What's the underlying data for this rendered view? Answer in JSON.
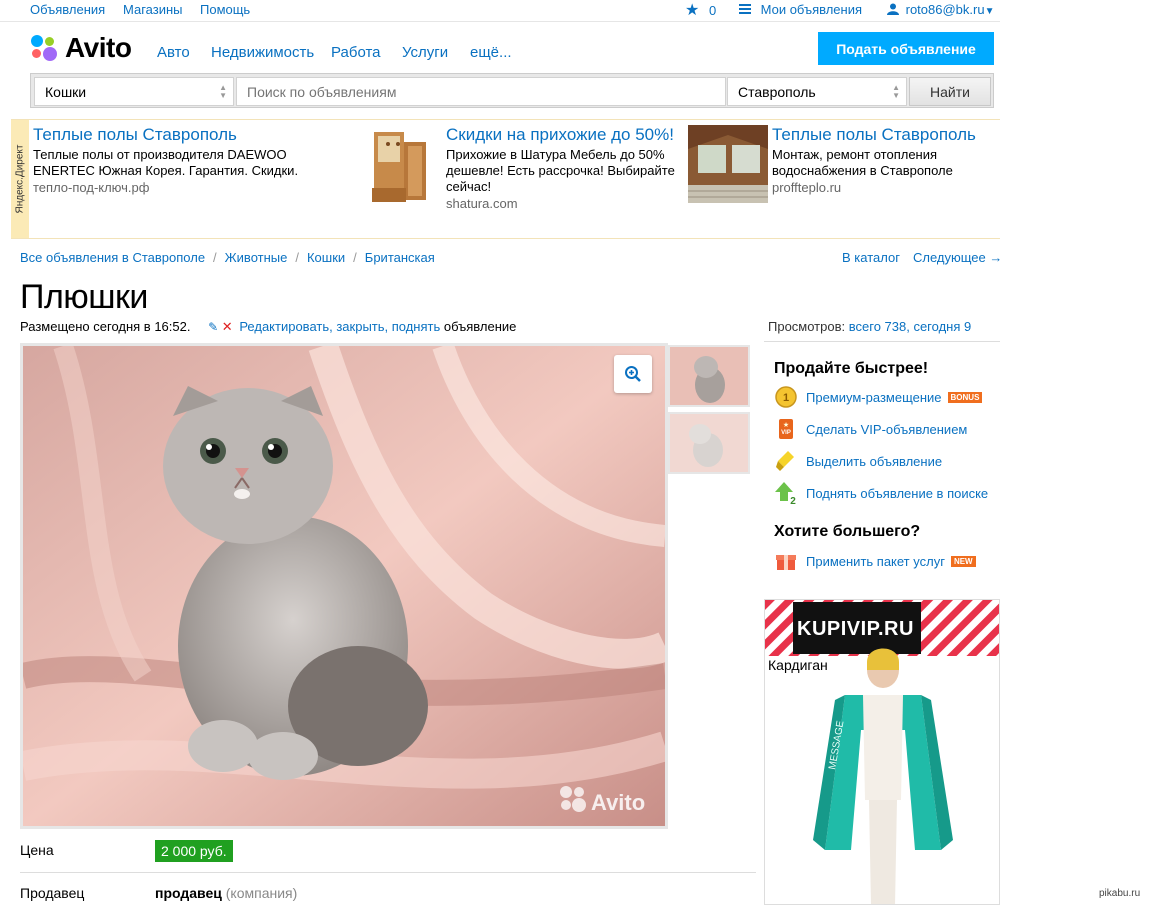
{
  "topbar": {
    "links": [
      "Объявления",
      "Магазины",
      "Помощь"
    ],
    "favorites_count": "0",
    "my_ads": "Мои объявления",
    "user": "roto86@bk.ru"
  },
  "header": {
    "logo_text": "Avito",
    "nav": [
      "Авто",
      "Недвижимость",
      "Работа",
      "Услуги",
      "ещё..."
    ],
    "post_button": "Подать объявление"
  },
  "search": {
    "category": "Кошки",
    "placeholder": "Поиск по объявлениям",
    "city": "Ставрополь",
    "button": "Найти"
  },
  "ads": {
    "label": "Яндекс.Директ",
    "items": [
      {
        "title": "Теплые полы Ставрополь",
        "desc": "Теплые полы от производителя DAEWOO ENERTEC Южная Корея. Гарантия. Скидки.",
        "url": "тепло-под-ключ.рф"
      },
      {
        "title": "Скидки на прихожие до 50%!",
        "desc": "Прихожие в Шатура Мебель до 50% дешевле! Есть рассрочка! Выбирайте сейчас!",
        "url": "shatura.com"
      },
      {
        "title": "Теплые полы Ставрополь",
        "desc": "Монтаж, ремонт отопления водоснабжения в Ставрополе",
        "url": "proffteplo.ru"
      }
    ]
  },
  "breadcrumbs": [
    "Все объявления в Ставрополе",
    "Животные",
    "Кошки",
    "Британская"
  ],
  "nav_right": {
    "catalog": "В каталог",
    "next": "Следующее →"
  },
  "listing": {
    "title": "Плюшки",
    "posted": "Размещено сегодня в 16:52.",
    "edit_links": "Редактировать, закрыть, поднять",
    "edit_suffix": "объявление",
    "views_label": "Просмотров:",
    "views_value": "всего 738, сегодня 9",
    "watermark": "Avito",
    "price_label": "Цена",
    "price": "2 000 руб.",
    "seller_label": "Продавец",
    "seller_name": "продавец",
    "seller_type": "(компания)"
  },
  "sidebar": {
    "sell_faster": "Продайте быстрее!",
    "services": [
      {
        "label": "Премиум-размещение",
        "badge": "BONUS"
      },
      {
        "label": "Сделать VIP-объявлением",
        "badge": ""
      },
      {
        "label": "Выделить объявление",
        "badge": ""
      },
      {
        "label": "Поднять объявление в поиске",
        "badge": ""
      }
    ],
    "want_more": "Хотите большего?",
    "package": {
      "label": "Применить пакет услуг",
      "badge": "NEW"
    }
  },
  "banner": {
    "brand": "KUPIVIP.RU",
    "caption": "Кардиган"
  },
  "watermark_site": "pikabu.ru",
  "colors": {
    "link": "#0a71c1",
    "post_button": "#00aaff",
    "price_badge": "#20a020",
    "tag": "#f06e1e"
  }
}
